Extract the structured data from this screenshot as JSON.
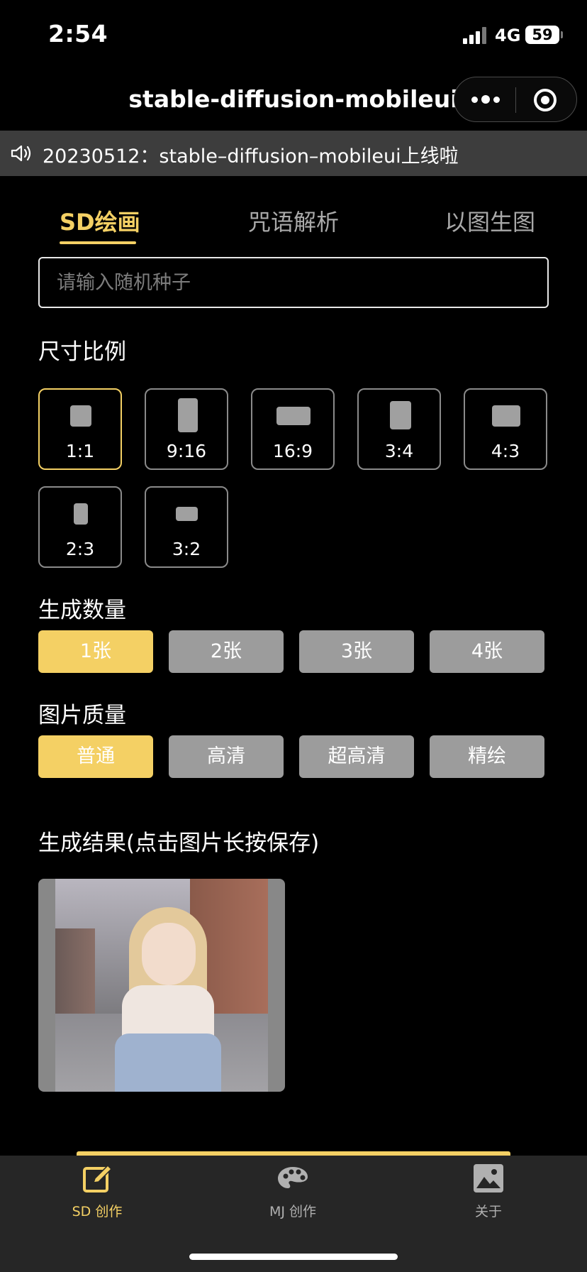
{
  "status_bar": {
    "time": "2:54",
    "network": "4G",
    "battery": "59"
  },
  "header": {
    "title": "stable-diffusion-mobileui"
  },
  "notice": {
    "text": "20230512：stable–diffusion–mobileui上线啦"
  },
  "tabs": [
    {
      "label": "SD绘画",
      "active": true
    },
    {
      "label": "咒语解析",
      "active": false
    },
    {
      "label": "以图生图",
      "active": false
    }
  ],
  "seed": {
    "placeholder": "请输入随机种子",
    "value": ""
  },
  "ratio": {
    "label": "尺寸比例",
    "options": [
      {
        "label": "1:1",
        "selected": true
      },
      {
        "label": "9:16",
        "selected": false
      },
      {
        "label": "16:9",
        "selected": false
      },
      {
        "label": "3:4",
        "selected": false
      },
      {
        "label": "4:3",
        "selected": false
      },
      {
        "label": "2:3",
        "selected": false
      },
      {
        "label": "3:2",
        "selected": false
      }
    ]
  },
  "count": {
    "label": "生成数量",
    "options": [
      "1张",
      "2张",
      "3张",
      "4张"
    ],
    "selected": "1张"
  },
  "quality": {
    "label": "图片质量",
    "options": [
      "普通",
      "高清",
      "超高清",
      "精绘"
    ],
    "selected": "普通"
  },
  "result": {
    "label": "生成结果(点击图片长按保存)"
  },
  "tab_bar": [
    {
      "label": "SD 创作",
      "icon": "edit-icon",
      "active": true
    },
    {
      "label": "MJ 创作",
      "icon": "palette-icon",
      "active": false
    },
    {
      "label": "关于",
      "icon": "image-icon",
      "active": false
    }
  ],
  "colors": {
    "accent": "#f4d064",
    "background": "#000000",
    "button": "#9c9c9c",
    "notice_bg": "#3d3d3d",
    "tab_bar_bg": "#262626"
  }
}
